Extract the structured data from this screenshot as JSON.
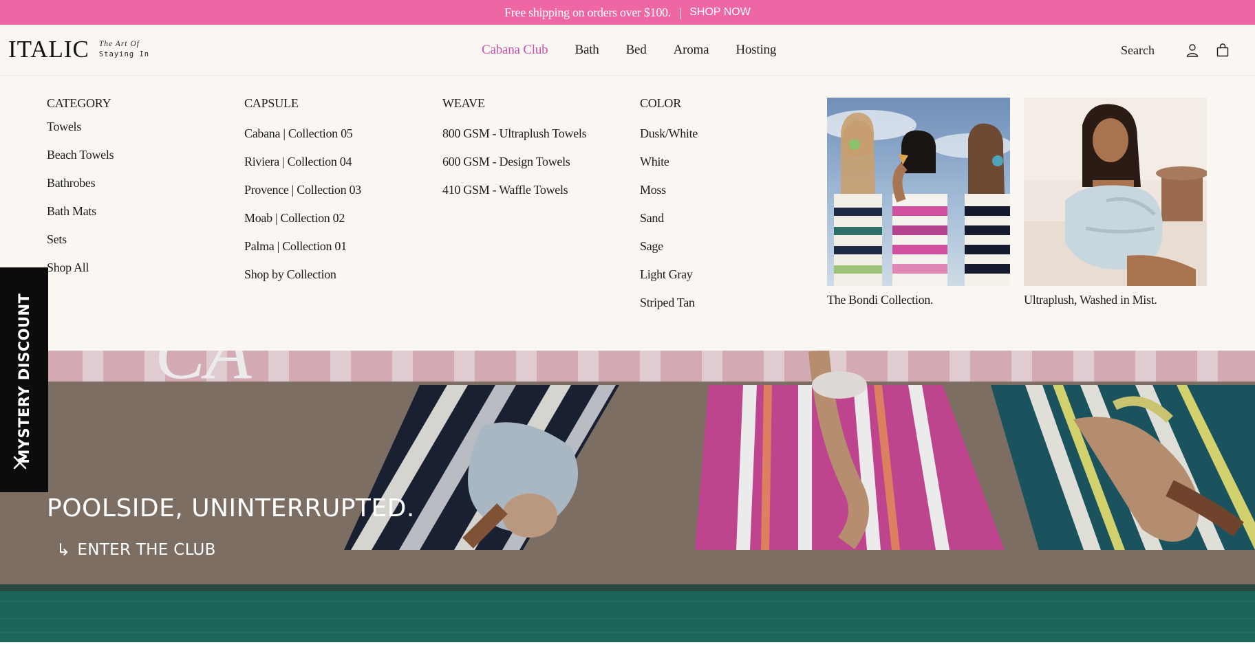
{
  "colors": {
    "announcement_bg": "#ee67a4",
    "active_nav": "#c64fb0",
    "menu_bg": "#faf7f2"
  },
  "announcement": {
    "text": "Free shipping on orders over $100.",
    "separator": "|",
    "cta": "SHOP NOW"
  },
  "header": {
    "logo": "ITALIC",
    "tagline_1": "The Art Of",
    "tagline_2": "Staying In",
    "nav": [
      {
        "label": "Cabana Club",
        "active": true
      },
      {
        "label": "Bath"
      },
      {
        "label": "Bed"
      },
      {
        "label": "Aroma"
      },
      {
        "label": "Hosting"
      }
    ],
    "search": "Search",
    "icons": [
      "account-icon",
      "cart-icon"
    ]
  },
  "mega_menu": {
    "category": {
      "heading": "CATEGORY",
      "items": [
        "Towels",
        "Beach Towels",
        "Bathrobes",
        "Bath Mats",
        "Sets",
        "Shop All"
      ]
    },
    "capsule": {
      "heading": "CAPSULE",
      "items": [
        "Cabana | Collection 05",
        "Riviera | Collection 04",
        "Provence | Collection 03",
        "Moab | Collection 02",
        "Palma | Collection 01",
        "Shop by Collection"
      ]
    },
    "weave": {
      "heading": "WEAVE",
      "items": [
        "800 GSM - Ultraplush Towels",
        "600 GSM - Design Towels",
        "410 GSM - Waffle Towels"
      ]
    },
    "color": {
      "heading": "COLOR",
      "items": [
        "Dusk/White",
        "White",
        "Moss",
        "Sand",
        "Sage",
        "Light Gray",
        "Striped Tan"
      ]
    },
    "promos": [
      {
        "caption": "The Bondi Collection."
      },
      {
        "caption": "Ultraplush, Washed in Mist."
      }
    ]
  },
  "hero": {
    "title": "POOLSIDE, UNINTERRUPTED.",
    "link_arrow": "↳",
    "link": "ENTER THE CLUB"
  },
  "mystery_tab": {
    "label": "MYSTERY DISCOUNT"
  }
}
